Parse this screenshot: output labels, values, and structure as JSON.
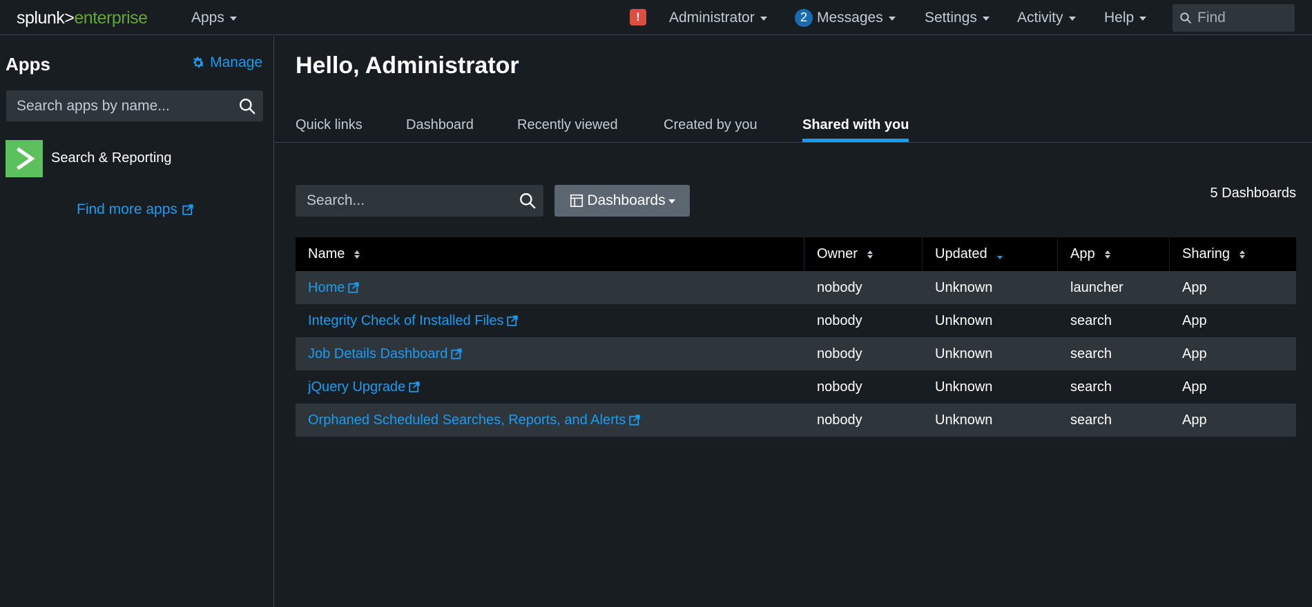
{
  "topbar": {
    "logo_left": "splunk>",
    "logo_right": "enterprise",
    "apps_label": "Apps",
    "alert_symbol": "!",
    "user_label": "Administrator",
    "messages_count": "2",
    "messages_label": "Messages",
    "settings_label": "Settings",
    "activity_label": "Activity",
    "help_label": "Help",
    "find_placeholder": "Find"
  },
  "sidebar": {
    "title": "Apps",
    "manage_label": "Manage",
    "search_placeholder": "Search apps by name...",
    "apps": [
      {
        "label": "Search & Reporting",
        "icon": "chevron-right-icon"
      }
    ],
    "find_more_label": "Find more apps"
  },
  "main": {
    "greeting": "Hello, Administrator",
    "tabs": [
      {
        "label": "Quick links"
      },
      {
        "label": "Dashboard"
      },
      {
        "label": "Recently viewed"
      },
      {
        "label": "Created by you"
      },
      {
        "label": "Shared with you",
        "active": true
      }
    ],
    "search_placeholder": "Search...",
    "filter_label": "Dashboards",
    "count_label": "5 Dashboards",
    "table": {
      "headers": [
        "Name",
        "Owner",
        "Updated",
        "App",
        "Sharing"
      ],
      "sorted_column": "Updated",
      "rows": [
        {
          "name": "Home",
          "owner": "nobody",
          "updated": "Unknown",
          "app": "launcher",
          "sharing": "App"
        },
        {
          "name": "Integrity Check of Installed Files",
          "owner": "nobody",
          "updated": "Unknown",
          "app": "search",
          "sharing": "App"
        },
        {
          "name": "Job Details Dashboard",
          "owner": "nobody",
          "updated": "Unknown",
          "app": "search",
          "sharing": "App"
        },
        {
          "name": "jQuery Upgrade",
          "owner": "nobody",
          "updated": "Unknown",
          "app": "search",
          "sharing": "App"
        },
        {
          "name": "Orphaned Scheduled Searches, Reports, and Alerts",
          "owner": "nobody",
          "updated": "Unknown",
          "app": "search",
          "sharing": "App"
        }
      ]
    }
  },
  "colors": {
    "background": "#171d21",
    "accent": "#1a9cf0",
    "brand_green": "#65a637",
    "alert_red": "#dc4e41",
    "row_alt": "#2e353b"
  }
}
